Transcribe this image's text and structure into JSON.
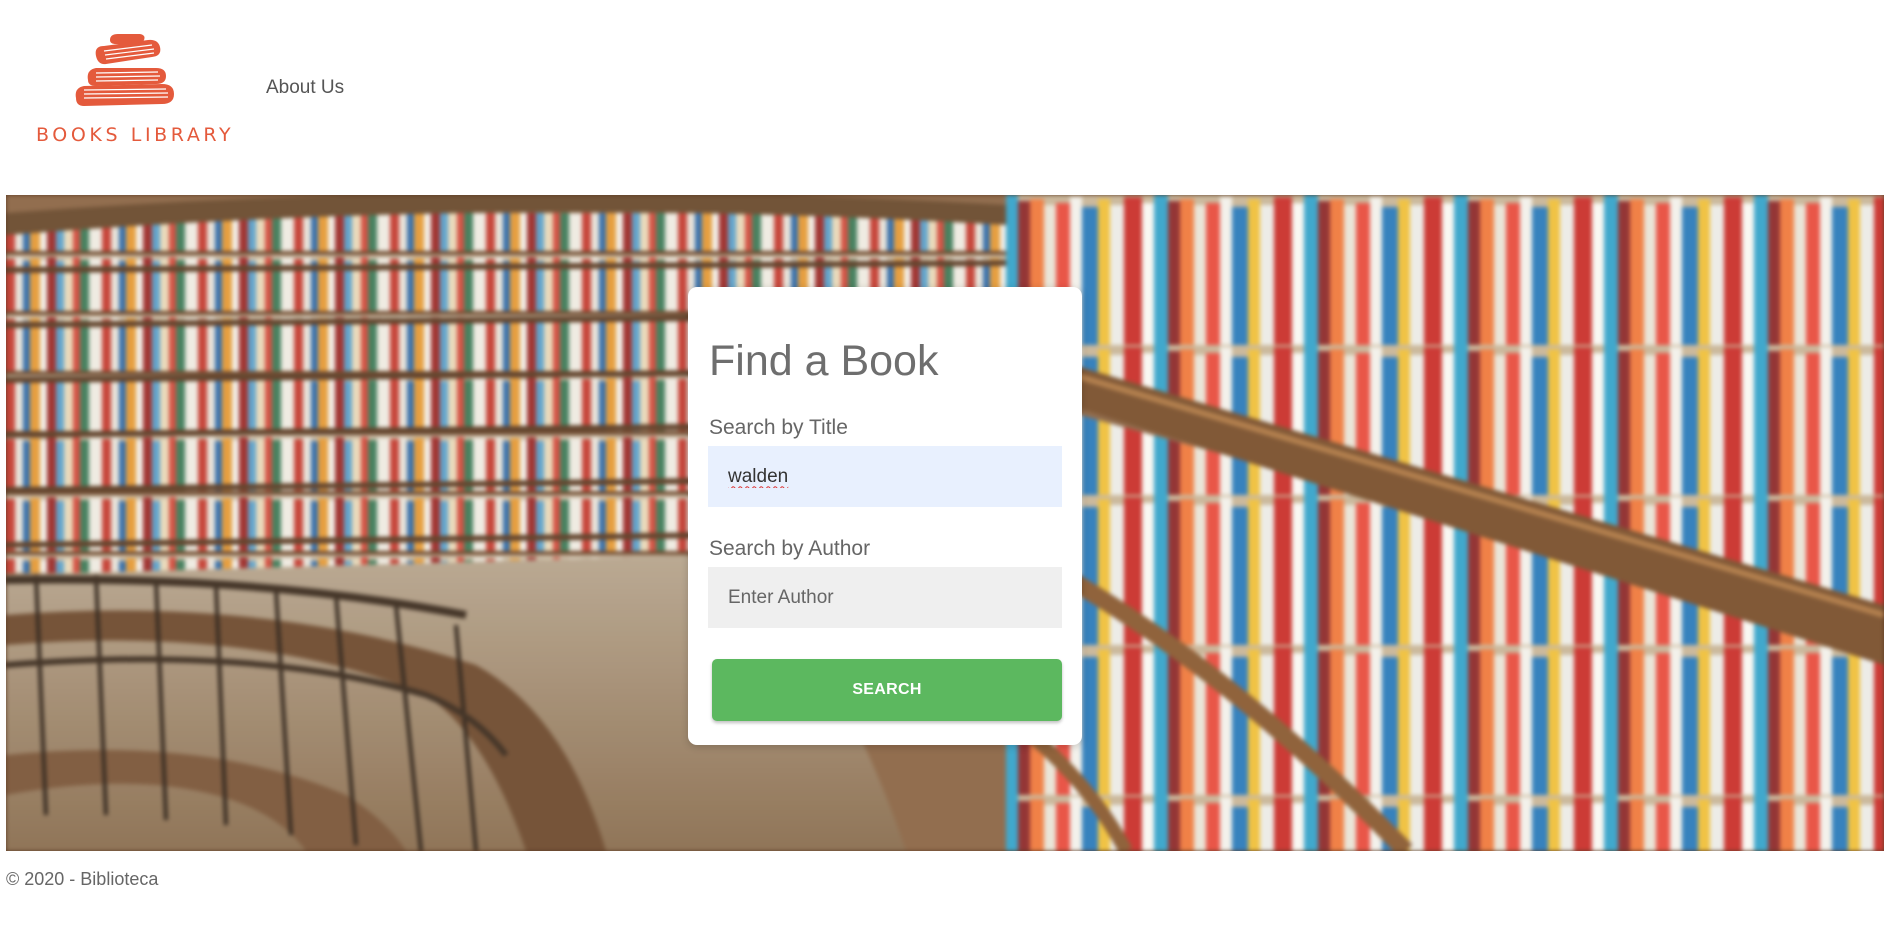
{
  "header": {
    "logo_text": "BOOKS LIBRARY",
    "logo_icon": "stacked-books-icon",
    "nav": {
      "about_label": "About Us"
    }
  },
  "search_card": {
    "title": "Find a Book",
    "title_label": "Search by Title",
    "title_value": "walden",
    "author_label": "Search by Author",
    "author_placeholder": "Enter Author",
    "author_value": "",
    "search_button_label": "SEARCH"
  },
  "footer": {
    "text": "© 2020 - Biblioteca"
  },
  "colors": {
    "brand": "#e45a3c",
    "button": "#5cb85f",
    "title_input_bg": "#e8f0fe",
    "author_input_bg": "#efefef"
  }
}
